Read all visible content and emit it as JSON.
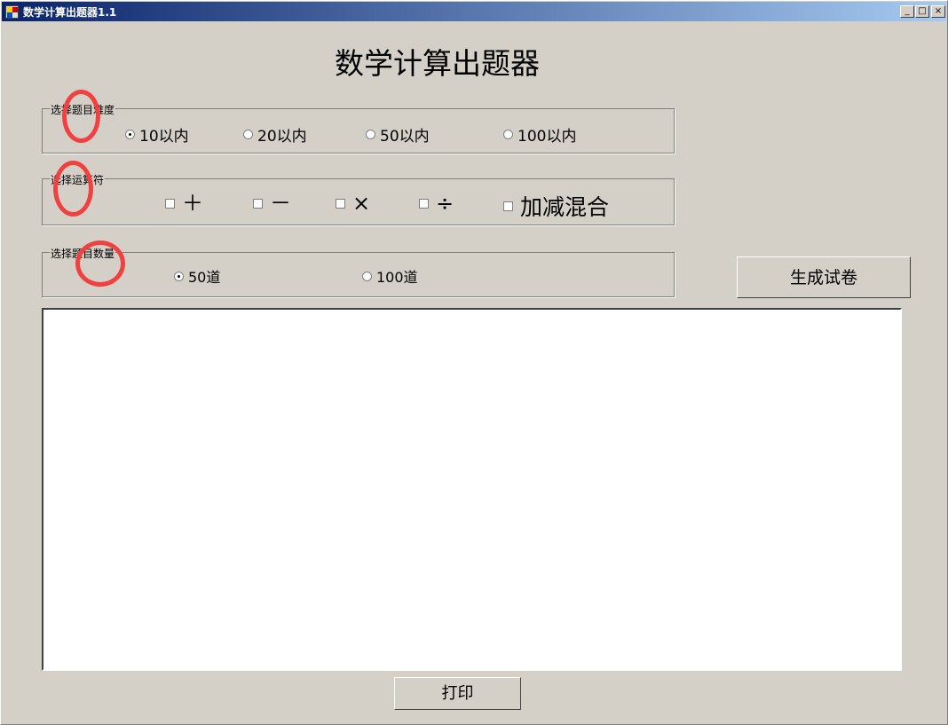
{
  "window": {
    "title": "数学计算出题器1.1",
    "controls": {
      "minimize": "_",
      "maximize": "□",
      "close": "×"
    }
  },
  "header": {
    "title": "数学计算出题器"
  },
  "difficulty": {
    "legend": "选择题目难度",
    "options": [
      {
        "label": "10以内",
        "checked": true
      },
      {
        "label": "20以内",
        "checked": false
      },
      {
        "label": "50以内",
        "checked": false
      },
      {
        "label": "100以内",
        "checked": false
      }
    ]
  },
  "operators": {
    "legend": "选择运算符",
    "options": [
      {
        "label": "＋",
        "checked": false
      },
      {
        "label": "－",
        "checked": false
      },
      {
        "label": "×",
        "checked": false
      },
      {
        "label": "÷",
        "checked": false
      },
      {
        "label": "加减混合",
        "checked": false
      }
    ]
  },
  "quantity": {
    "legend": "选择题目数量",
    "options": [
      {
        "label": "50道",
        "checked": true
      },
      {
        "label": "100道",
        "checked": false
      }
    ]
  },
  "actions": {
    "generate": "生成试卷",
    "print": "打印"
  },
  "output": {
    "text": ""
  },
  "colors": {
    "titlebar_start": "#0a246a",
    "titlebar_end": "#a6caf0",
    "window_bg": "#d4d0c8",
    "annotation": "#f04040"
  }
}
